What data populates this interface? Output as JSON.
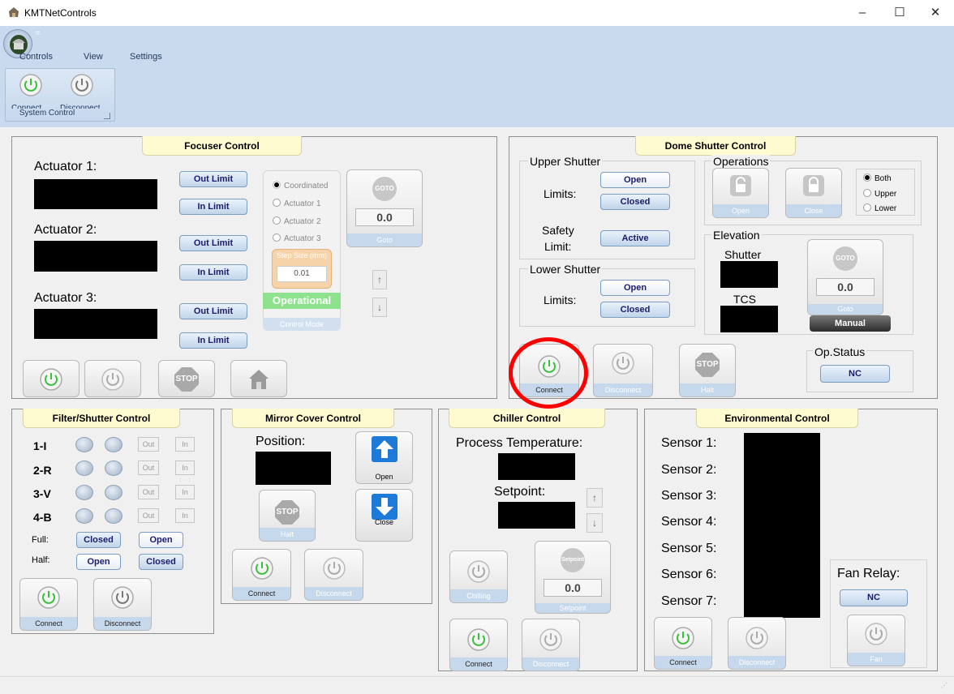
{
  "window": {
    "title": "KMTNetControls",
    "minimize": "–",
    "maximize": "☐",
    "close": "✕"
  },
  "ribbon": {
    "menu": [
      "Controls",
      "View",
      "Settings"
    ],
    "qa": "=",
    "group": {
      "label": "System Control",
      "connect": "Connect",
      "disconnect": "Disconnect"
    }
  },
  "focuser": {
    "title": "Focuser Control",
    "actuators": [
      "Actuator 1:",
      "Actuator 2:",
      "Actuator 3:"
    ],
    "out_limit": "Out Limit",
    "in_limit": "In Limit",
    "modes": [
      "Coordinated",
      "Actuator 1",
      "Actuator 2",
      "Actuator 3"
    ],
    "step_label": "Step Size (mm)",
    "step_value": "0.01",
    "state": "Operational",
    "mode_caption": "Control Mode",
    "goto_icon": "GOTO",
    "goto_value": "0.0",
    "goto_caption": "Goto",
    "stop": "STOP"
  },
  "dome": {
    "title": "Dome Shutter Control",
    "upper": "Upper Shutter",
    "limits": "Limits:",
    "open": "Open",
    "closed": "Closed",
    "safety": "Safety",
    "limit": "Limit:",
    "active": "Active",
    "lower": "Lower Shutter",
    "operations": "Operations",
    "op_open": "Open",
    "op_close": "Close",
    "radios": [
      "Both",
      "Upper",
      "Lower"
    ],
    "elevation": "Elevation",
    "shutter": "Shutter",
    "tcs": "TCS",
    "goto_icon": "GOTO",
    "goto_value": "0.0",
    "goto_caption": "Goto",
    "manual": "Manual",
    "connect": "Connect",
    "disconnect": "Disconnect",
    "halt": "Halt",
    "stop": "STOP",
    "opstatus": "Op.Status",
    "opstatus_value": "NC"
  },
  "filter": {
    "title": "Filter/Shutter Control",
    "rows": [
      "1-I",
      "2-R",
      "3-V",
      "4-B"
    ],
    "out": "Out",
    "in": "In",
    "full": "Full:",
    "half": "Half:",
    "full_a": "Closed",
    "full_b": "Open",
    "half_a": "Open",
    "half_b": "Closed",
    "connect": "Connect",
    "disconnect": "Disconnect"
  },
  "mirror": {
    "title": "Mirror Cover Control",
    "position": "Position:",
    "open": "Open",
    "close": "Close",
    "halt": "Halt",
    "stop": "STOP",
    "connect": "Connect",
    "disconnect": "Disconnect"
  },
  "chiller": {
    "title": "Chiller Control",
    "process": "Process Temperature:",
    "setpoint": "Setpoint:",
    "chilling": "Chilling",
    "sp_icon": "Setpoint",
    "sp_value": "0.0",
    "sp_caption": "Setpoint",
    "connect": "Connect",
    "disconnect": "Disconnect"
  },
  "env": {
    "title": "Environmental Control",
    "sensors": [
      "Sensor 1:",
      "Sensor 2:",
      "Sensor 3:",
      "Sensor 4:",
      "Sensor 5:",
      "Sensor 6:",
      "Sensor 7:"
    ],
    "fan_relay": "Fan Relay:",
    "fan_value": "NC",
    "fan": "Fan",
    "connect": "Connect",
    "disconnect": "Disconnect"
  },
  "colors": {
    "power_on": "#3cbf3c",
    "power_off": "#8a8a8a",
    "highlight": "#ff0000",
    "panel_title": "#fffbd0"
  }
}
